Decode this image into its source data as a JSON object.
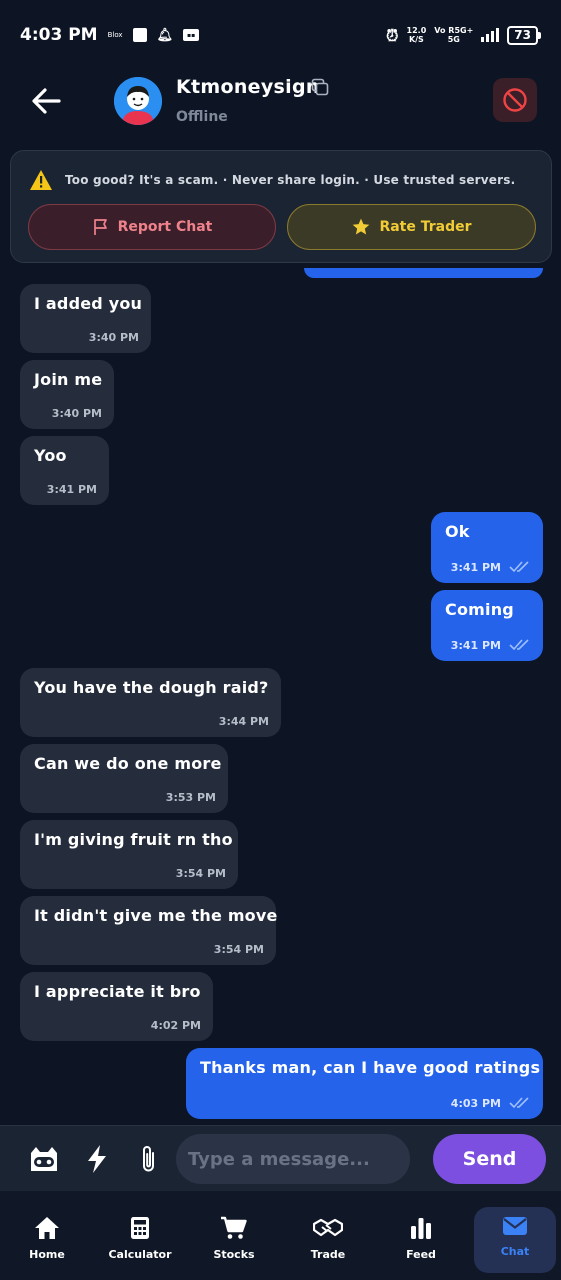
{
  "status_bar": {
    "time": "4:03 PM",
    "mini_label": "Blox",
    "network_speed_value": "12.0",
    "network_speed_unit": "K/S",
    "network_type_top": "Vo R5G+",
    "network_type_bottom": "5G",
    "battery": "73"
  },
  "header": {
    "contact_name": "Ktmoneysign",
    "contact_status": "Offline"
  },
  "safety": {
    "warning_text": "Too good? It's a scam. · Never share login. · Use trusted servers.",
    "report_label": "Report Chat",
    "rate_label": "Rate Trader",
    "report_color": "#f0828c",
    "rate_color": "#f1cc36"
  },
  "messages": [
    {
      "direction": "in",
      "text": "I added you",
      "time": "3:40 PM"
    },
    {
      "direction": "in",
      "text": "Join me",
      "time": "3:40 PM"
    },
    {
      "direction": "in",
      "text": "Yoo",
      "time": "3:41 PM"
    },
    {
      "direction": "out",
      "text": "Ok",
      "time": "3:41 PM",
      "read": true
    },
    {
      "direction": "out",
      "text": "Coming",
      "time": "3:41 PM",
      "read": true
    },
    {
      "direction": "in",
      "text": "You have the dough raid?",
      "time": "3:44 PM"
    },
    {
      "direction": "in",
      "text": "Can we do one more",
      "time": "3:53 PM"
    },
    {
      "direction": "in",
      "text": "I'm giving fruit rn tho",
      "time": "3:54 PM"
    },
    {
      "direction": "in",
      "text": "It didn't give me the move",
      "time": "3:54 PM"
    },
    {
      "direction": "in",
      "text": "I appreciate it bro",
      "time": "4:02 PM"
    },
    {
      "direction": "out",
      "text": "Thanks man, can I have good ratings",
      "time": "4:03 PM",
      "read": true
    }
  ],
  "composer": {
    "placeholder": "Type a message...",
    "value": "",
    "send_label": "Send"
  },
  "bottom_nav": {
    "items": [
      {
        "label": "Home",
        "icon": "home-icon"
      },
      {
        "label": "Calculator",
        "icon": "calculator-icon"
      },
      {
        "label": "Stocks",
        "icon": "cart-icon"
      },
      {
        "label": "Trade",
        "icon": "handshake-icon"
      },
      {
        "label": "Feed",
        "icon": "bar-chart-icon"
      },
      {
        "label": "Chat",
        "icon": "mail-icon"
      }
    ],
    "active": "Chat",
    "active_color": "#3b82f6"
  },
  "colors": {
    "background": "#0d1525",
    "incoming_bubble": "#252d3d",
    "outgoing_bubble": "#2563eb",
    "send_button": "#7c4fe0"
  }
}
